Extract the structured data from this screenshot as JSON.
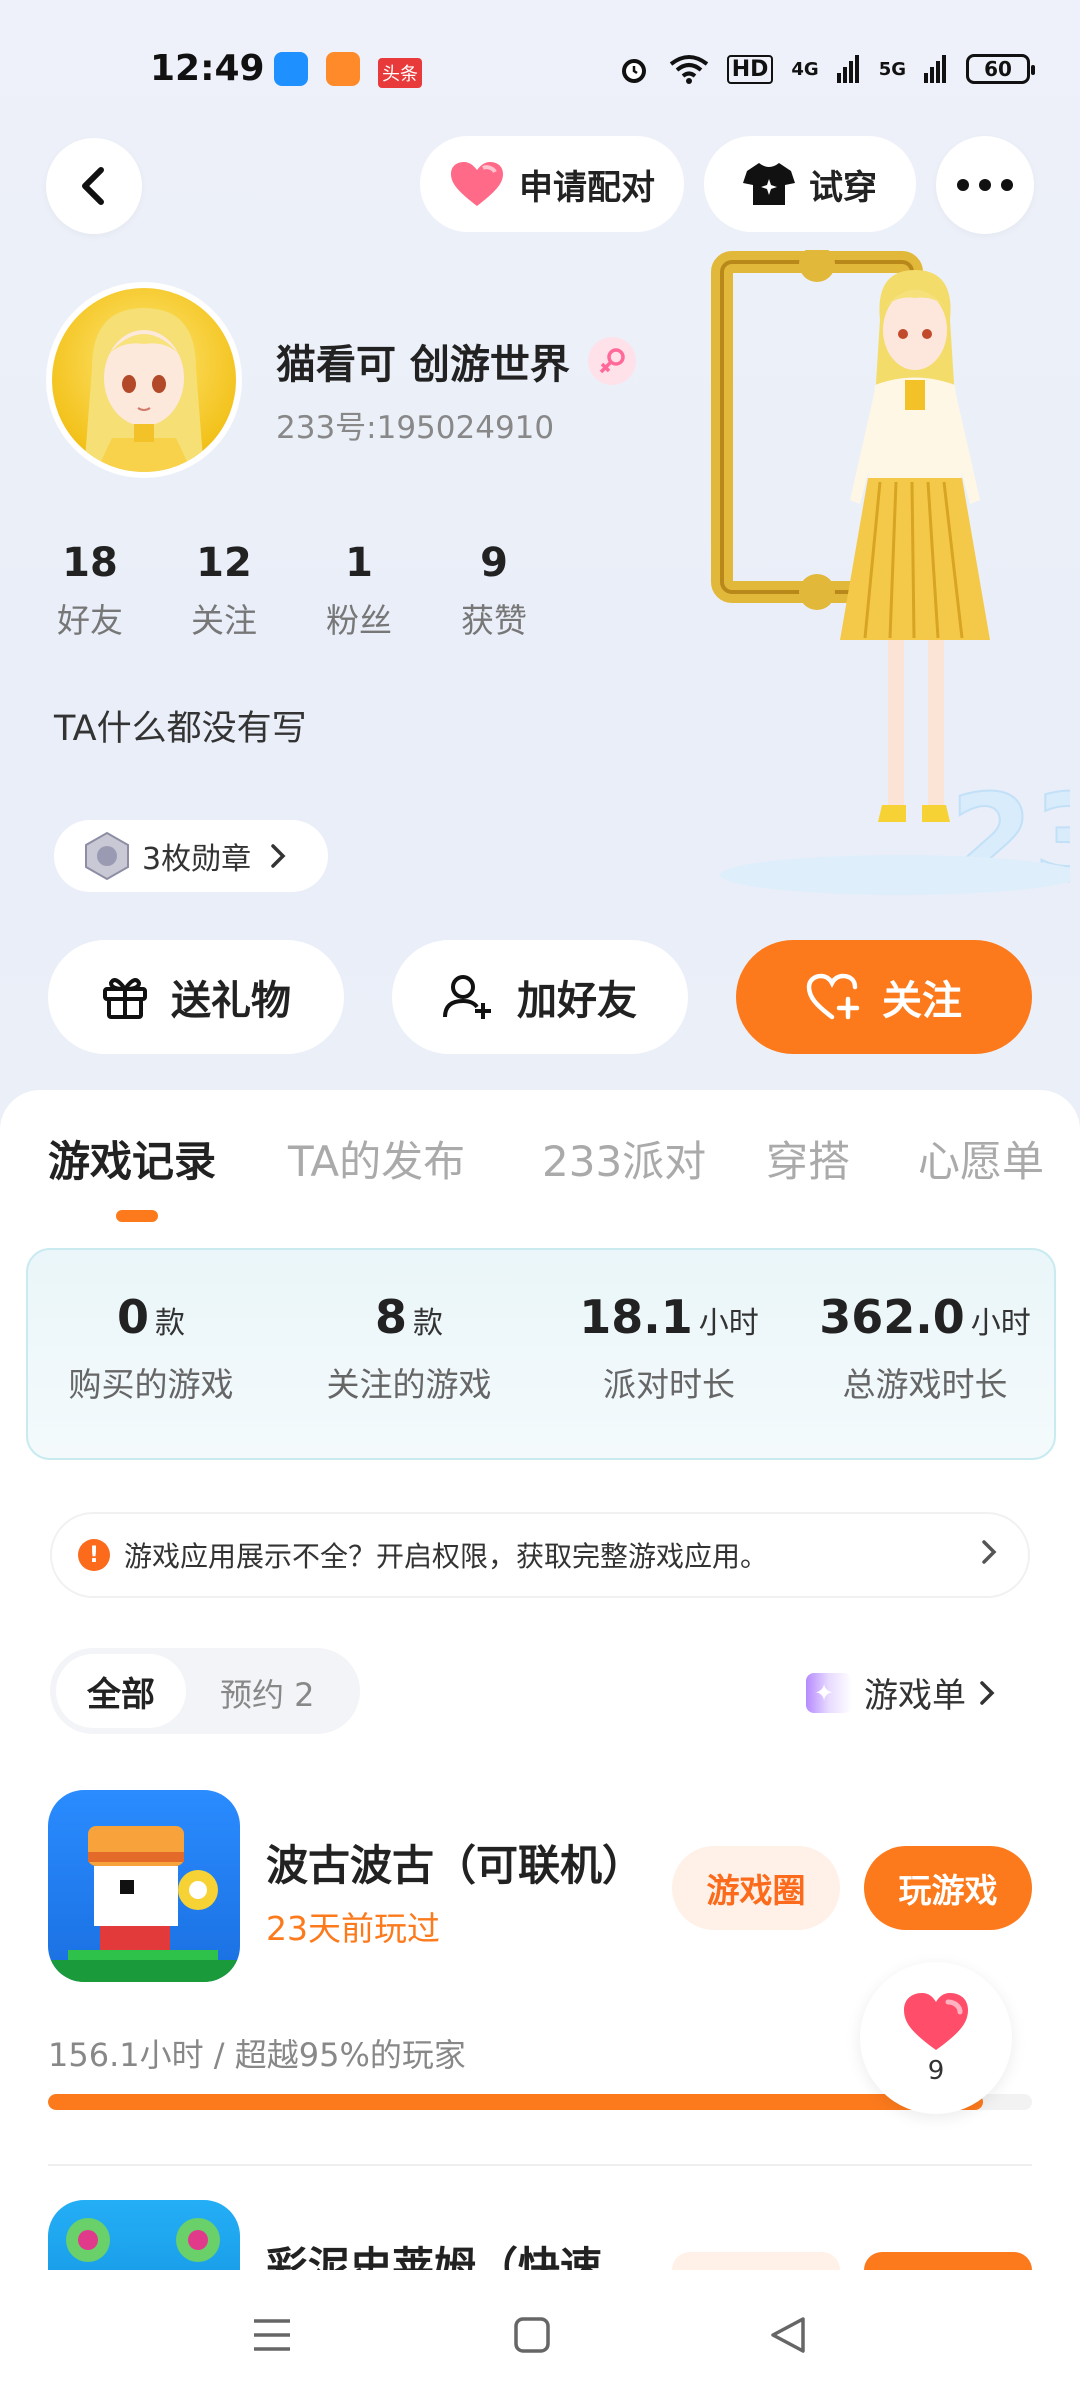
{
  "status_bar": {
    "time": "12:49",
    "app_badge": "头条",
    "network": "4G",
    "network2": "5G",
    "hd": "HD",
    "battery": "60"
  },
  "header": {
    "back_icon": "chevron-left-icon",
    "match_label": "申请配对",
    "tryon_label": "试穿",
    "more_icon": "more-horizontal-icon"
  },
  "profile": {
    "name": "猫看可  创游世界",
    "uid": "233号:195024910",
    "stats": [
      {
        "value": "18",
        "label": "好友"
      },
      {
        "value": "12",
        "label": "关注"
      },
      {
        "value": "1",
        "label": "粉丝"
      },
      {
        "value": "9",
        "label": "获赞"
      }
    ],
    "bio": "TA什么都没有写",
    "medal_label": "3枚勋章"
  },
  "actions": {
    "gift": "送礼物",
    "add_friend": "加好友",
    "follow": "关注"
  },
  "tabs": [
    {
      "label": "游戏记录",
      "active": true
    },
    {
      "label": "TA的发布",
      "active": false
    },
    {
      "label": "233派对",
      "active": false
    },
    {
      "label": "穿搭",
      "active": false
    },
    {
      "label": "心愿单",
      "active": false
    }
  ],
  "game_stats": [
    {
      "value": "0",
      "unit": "款",
      "label": "购买的游戏"
    },
    {
      "value": "8",
      "unit": "款",
      "label": "关注的游戏"
    },
    {
      "value": "18.1",
      "unit": "小时",
      "label": "派对时长"
    },
    {
      "value": "362.0",
      "unit": "小时",
      "label": "总游戏时长"
    }
  ],
  "notice": {
    "text": "游戏应用展示不全？开启权限，获取完整游戏应用。"
  },
  "filters": {
    "all": "全部",
    "reserved": "预约 2",
    "gamelist": "游戏单"
  },
  "games": [
    {
      "title": "波古波古（可联机）",
      "last_played": "23天前玩过",
      "circle_btn": "游戏圈",
      "play_btn": "玩游戏",
      "stat": "156.1小时 / 超越95%的玩家",
      "progress": 0.95
    },
    {
      "title": "彩泥史莱姆（快速"
    }
  ],
  "like_fab": {
    "count": "9"
  },
  "colors": {
    "accent": "#fc7a1c",
    "heart": "#ff4d6a"
  }
}
